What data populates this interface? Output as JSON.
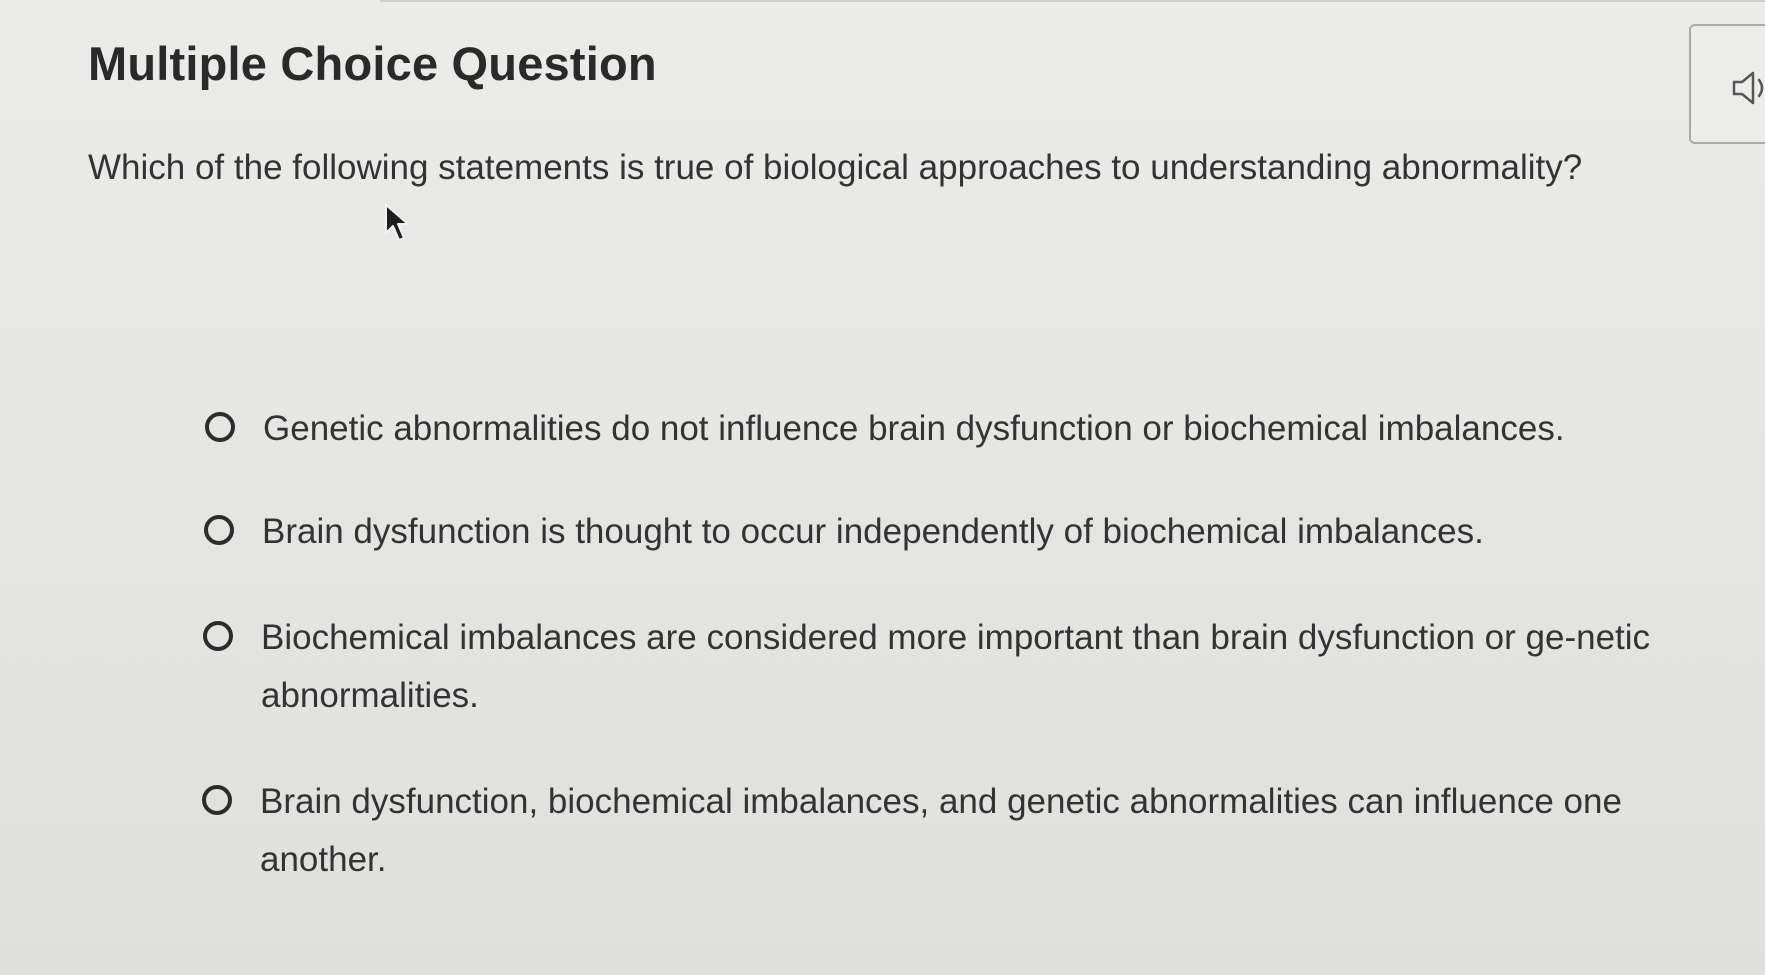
{
  "header": {
    "title": "Multiple Choice Question"
  },
  "audio": {
    "icon": "speaker-icon"
  },
  "question": {
    "text": "Which of the following statements is true of biological approaches to understanding abnormality?"
  },
  "options": [
    {
      "text": "Genetic abnormalities do not influence brain dysfunction or biochemical imbalances.",
      "selected": false
    },
    {
      "text": "Brain dysfunction is thought to occur independently of biochemical imbalances.",
      "selected": false
    },
    {
      "text": "Biochemical imbalances are considered more important than brain dysfunction or ge-netic abnormalities.",
      "selected": false
    },
    {
      "text": "Brain dysfunction, biochemical imbalances, and genetic abnormalities can influence one another.",
      "selected": false
    }
  ],
  "colors": {
    "background": "#e6e6e4",
    "text": "#2b2b2b",
    "radio_border": "#2c2c2c"
  }
}
